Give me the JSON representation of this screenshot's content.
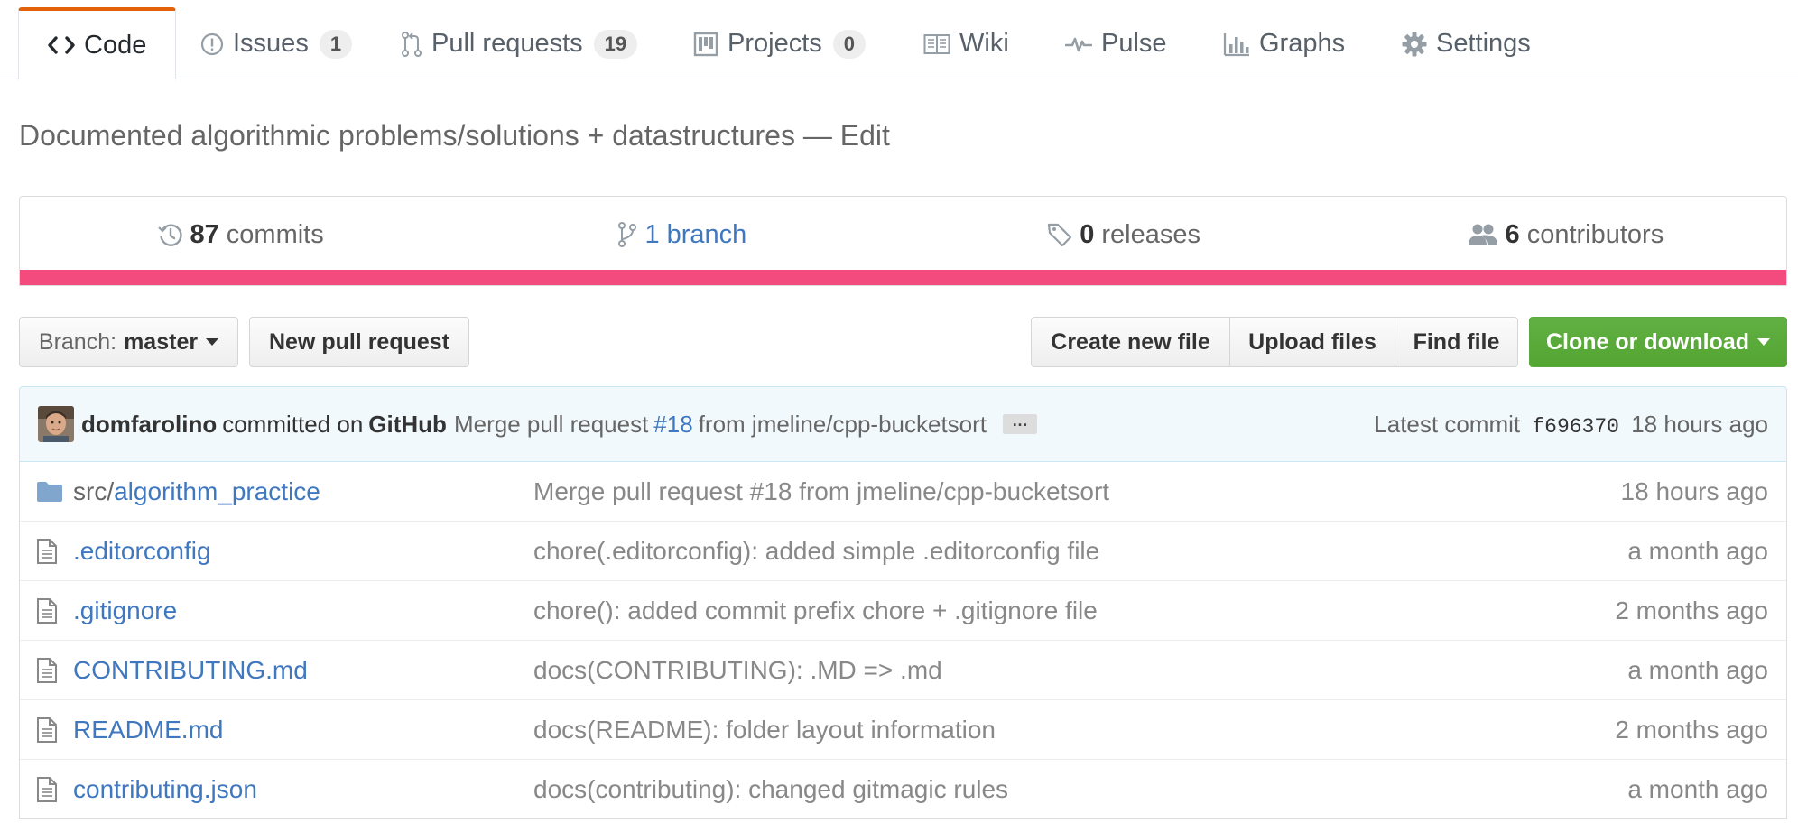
{
  "tabs": [
    {
      "label": "Code",
      "icon": "code-icon",
      "selected": true
    },
    {
      "label": "Issues",
      "icon": "issue-icon",
      "count": "1"
    },
    {
      "label": "Pull requests",
      "icon": "pull-request-icon",
      "count": "19"
    },
    {
      "label": "Projects",
      "icon": "project-icon",
      "count": "0"
    },
    {
      "label": "Wiki",
      "icon": "book-icon"
    },
    {
      "label": "Pulse",
      "icon": "pulse-icon"
    },
    {
      "label": "Graphs",
      "icon": "graph-icon"
    },
    {
      "label": "Settings",
      "icon": "gear-icon"
    }
  ],
  "repo": {
    "description": "Documented algorithmic problems/solutions + datastructures",
    "edit_label": "Edit"
  },
  "summary": {
    "commits": {
      "count": "87",
      "label": "commits"
    },
    "branches": {
      "count": "1",
      "label": "branch"
    },
    "releases": {
      "count": "0",
      "label": "releases"
    },
    "contributors": {
      "count": "6",
      "label": "contributors"
    },
    "language_bar_color": "#f34b7d"
  },
  "toolbar": {
    "branch_prefix": "Branch:",
    "branch_name": "master",
    "new_pull_request": "New pull request",
    "create_new_file": "Create new file",
    "upload_files": "Upload files",
    "find_file": "Find file",
    "clone_or_download": "Clone or download"
  },
  "latest_commit": {
    "author": "domfarolino",
    "committed_on": "committed on",
    "via": "GitHub",
    "message_prefix": "Merge pull request",
    "pr_number": "#18",
    "message_suffix": "from jmeline/cpp-bucketsort",
    "ellipsis": "…",
    "latest_label": "Latest commit",
    "sha": "f696370",
    "age": "18 hours ago"
  },
  "files": [
    {
      "type": "dir",
      "name_prefix": "src/",
      "name": "algorithm_practice",
      "message": "Merge pull request #18 from jmeline/cpp-bucketsort",
      "age": "18 hours ago"
    },
    {
      "type": "file",
      "name_prefix": "",
      "name": ".editorconfig",
      "message": "chore(.editorconfig): added simple .editorconfig file",
      "age": "a month ago"
    },
    {
      "type": "file",
      "name_prefix": "",
      "name": ".gitignore",
      "message": "chore(): added commit prefix chore + .gitignore file",
      "age": "2 months ago"
    },
    {
      "type": "file",
      "name_prefix": "",
      "name": "CONTRIBUTING.md",
      "message": "docs(CONTRIBUTING): .MD => .md",
      "age": "a month ago"
    },
    {
      "type": "file",
      "name_prefix": "",
      "name": "README.md",
      "message": "docs(README): folder layout information",
      "age": "2 months ago"
    },
    {
      "type": "file",
      "name_prefix": "",
      "name": "contributing.json",
      "message": "docs(contributing): changed gitmagic rules",
      "age": "a month ago"
    }
  ],
  "colors": {
    "link": "#4078c0",
    "tab_accent": "#e36209",
    "primary_button": "#55a532",
    "commit_tease_bg": "#f2f9fc"
  }
}
